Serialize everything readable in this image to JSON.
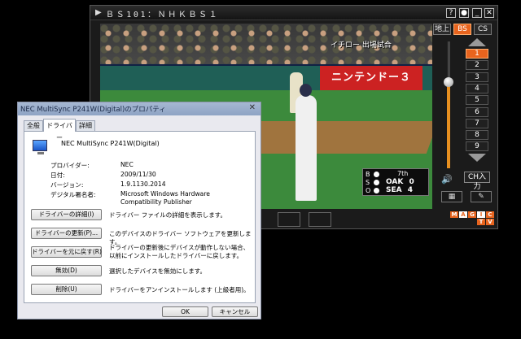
{
  "tv": {
    "channel_title": "ＢＳ101：ＮＨＫＢＳ１",
    "title_buttons": [
      "?",
      "●",
      "_",
      "✕"
    ],
    "overlay_text": "イチロー 出場試合",
    "ad_sign": "ニンテンドー３",
    "source_buttons": [
      {
        "label": "地上",
        "active": false
      },
      {
        "label": "BS",
        "active": true
      },
      {
        "label": "CS",
        "active": false
      }
    ],
    "channels": [
      {
        "label": "1",
        "active": true
      },
      {
        "label": "2",
        "active": false
      },
      {
        "label": "3",
        "active": false
      },
      {
        "label": "4",
        "active": false
      },
      {
        "label": "5",
        "active": false
      },
      {
        "label": "6",
        "active": false
      },
      {
        "label": "7",
        "active": false
      },
      {
        "label": "8",
        "active": false
      },
      {
        "label": "9",
        "active": false
      }
    ],
    "channel_input": "CH入力",
    "volume_level": 0.68,
    "scoreboard": {
      "bso": [
        "B",
        "S",
        "O"
      ],
      "inning": "7th",
      "teams": [
        {
          "name": "OAK",
          "score": "0"
        },
        {
          "name": "SEA",
          "score": "4"
        }
      ]
    },
    "logo": {
      "letters": [
        "M",
        "A",
        "G",
        "I",
        "C",
        "T",
        "V"
      ]
    },
    "colors": {
      "accent": "#e8641e",
      "panel": "#1b1b1b"
    }
  },
  "dialog": {
    "title": "NEC MultiSync P241W(Digital)のプロパティ",
    "close": "✕",
    "tabs": [
      {
        "label": "全般",
        "active": false
      },
      {
        "label": "ドライバー",
        "active": true
      },
      {
        "label": "詳細",
        "active": false
      }
    ],
    "device_name": "NEC MultiSync P241W(Digital)",
    "properties": [
      {
        "key": "プロバイダー:",
        "value": "NEC"
      },
      {
        "key": "日付:",
        "value": "2009/11/30"
      },
      {
        "key": "バージョン:",
        "value": "1.9.1130.2014"
      },
      {
        "key": "デジタル署名者:",
        "value": "Microsoft Windows Hardware Compatibility Publisher"
      }
    ],
    "actions": [
      {
        "button": "ドライバーの詳細(I)",
        "desc": "ドライバー ファイルの詳細を表示します。"
      },
      {
        "button": "ドライバーの更新(P)...",
        "desc": "このデバイスのドライバー ソフトウェアを更新します。"
      },
      {
        "button": "ドライバーを元に戻す(R)",
        "desc": "ドライバーの更新後にデバイスが動作しない場合、以前にインストールしたドライバーに戻します。"
      },
      {
        "button": "無効(D)",
        "desc": "選択したデバイスを無効にします。"
      },
      {
        "button": "削除(U)",
        "desc": "ドライバーをアンインストールします (上級者用)。"
      }
    ],
    "ok": "OK",
    "cancel": "キャンセル"
  }
}
